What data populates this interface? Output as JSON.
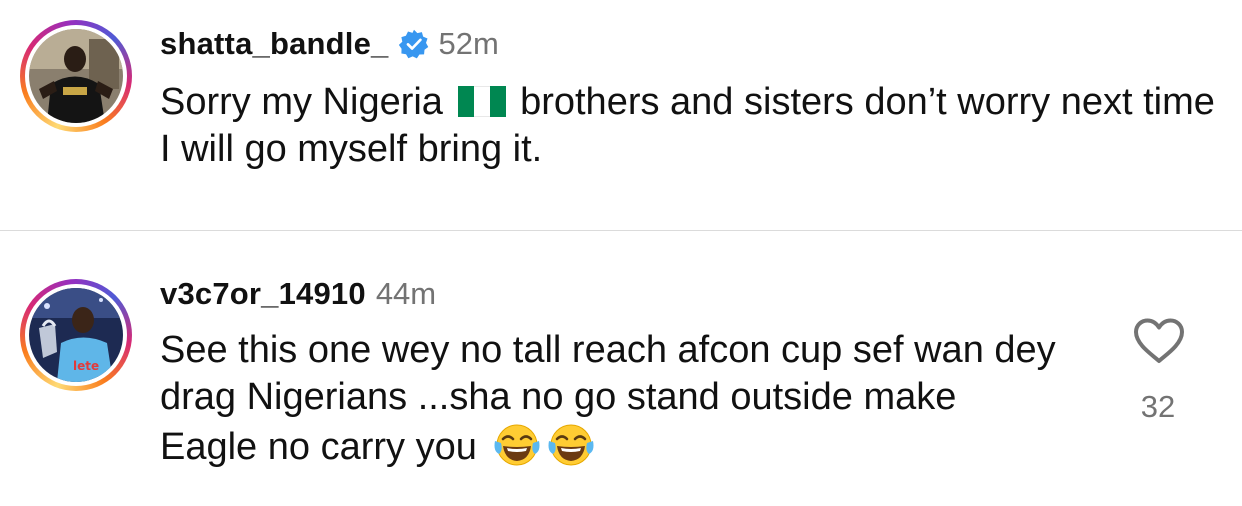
{
  "comments": [
    {
      "username": "shatta_bandle_",
      "verified": true,
      "time": "52m",
      "text_before_flag": "Sorry my Nigeria",
      "flag": "nigeria-flag",
      "text_after_flag": "brothers and sisters don’t worry next time I will go myself bring it."
    },
    {
      "username": "v3c7or_14910",
      "verified": false,
      "time": "44m",
      "text": "See this one wey no tall reach afcon cup sef wan dey drag Nigerians ...sha no go stand outside make Eagle no carry you",
      "emojis": [
        "face-with-tears-of-joy",
        "face-with-tears-of-joy"
      ],
      "like_count": "32"
    }
  ],
  "colors": {
    "verified_blue": "#3897f0",
    "muted_text": "#737373",
    "divider": "#dbdbdb",
    "flag_green": "#008751"
  },
  "icons": {
    "verified": "verified-badge-icon",
    "like": "heart-outline-icon"
  }
}
